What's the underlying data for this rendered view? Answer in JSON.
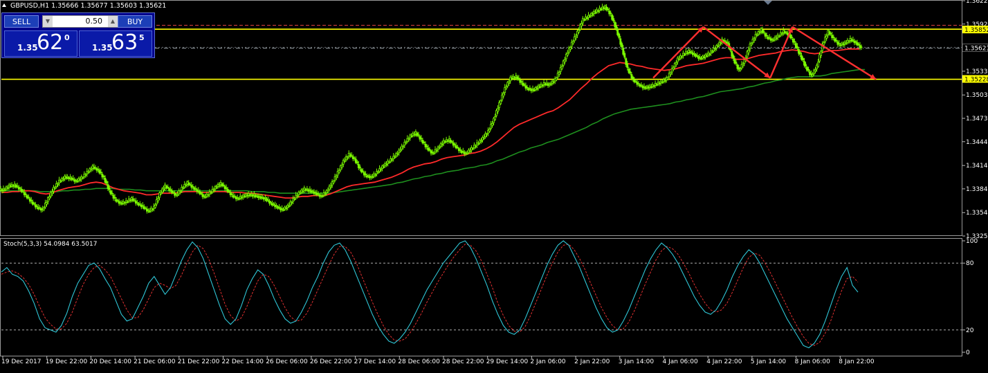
{
  "header": {
    "title": "GBPUSD,H1  1.35666 1.35677 1.35603 1.35621"
  },
  "one_click": {
    "sell_label": "SELL",
    "buy_label": "BUY",
    "lot": "0.50",
    "bid_prefix": "1.35",
    "bid_big": "62",
    "bid_sup": "0",
    "ask_prefix": "1.35",
    "ask_big": "63",
    "ask_sup": "5"
  },
  "colors": {
    "background": "#000000",
    "candle": "#7cfc00",
    "ma_fast": "#ff2a2a",
    "ma_slow": "#1e8f1e",
    "level": "#ffff00",
    "arrows": "#ff3030",
    "stoch_main": "#2fc6d6",
    "stoch_signal": "#e03030",
    "axis_text": "#ffffff"
  },
  "chart_data": [
    {
      "type": "candlestick",
      "symbol": "GBPUSD",
      "timeframe": "H1",
      "ohlc_current": {
        "open": 1.35666,
        "high": 1.35677,
        "low": 1.35603,
        "close": 1.35621
      },
      "price_ticks": [
        "1.36220",
        "1.35925",
        "1.35621",
        "1.35330",
        "1.35030",
        "1.34735",
        "1.34440",
        "1.34140",
        "1.33845",
        "1.33545",
        "1.33250"
      ],
      "ylim": [
        1.3325,
        1.3622
      ],
      "tick_values": [
        1.3622,
        1.35925,
        1.35625,
        1.3533,
        1.3503,
        1.34735,
        1.3444,
        1.3414,
        1.33845,
        1.33545,
        1.3325
      ],
      "time_labels": [
        "19 Dec 2017",
        "19 Dec 22:00",
        "20 Dec 14:00",
        "21 Dec 06:00",
        "21 Dec 22:00",
        "22 Dec 14:00",
        "26 Dec 06:00",
        "26 Dec 22:00",
        "27 Dec 14:00",
        "28 Dec 06:00",
        "28 Dec 22:00",
        "29 Dec 14:00",
        "2 Jan 06:00",
        "2 Jan 22:00",
        "3 Jan 14:00",
        "4 Jan 06:00",
        "4 Jan 22:00",
        "5 Jan 14:00",
        "8 Jan 06:00",
        "8 Jan 22:00"
      ],
      "price_labels": [
        {
          "text": "1.35852",
          "value": 1.35852,
          "highlight": true
        },
        {
          "text": "1.35621",
          "value": 1.35621,
          "highlight": false
        },
        {
          "text": "1.35228",
          "value": 1.35228,
          "highlight": true
        }
      ],
      "horizontal_levels": [
        1.35228,
        1.3586
      ],
      "closes": [
        1.3383,
        1.3388,
        1.3389,
        1.3384,
        1.3376,
        1.3368,
        1.3361,
        1.3358,
        1.3372,
        1.3385,
        1.3394,
        1.3399,
        1.3398,
        1.3394,
        1.3398,
        1.3405,
        1.3412,
        1.3408,
        1.3398,
        1.3382,
        1.3371,
        1.3366,
        1.3368,
        1.3372,
        1.3366,
        1.3362,
        1.3356,
        1.3361,
        1.3378,
        1.3388,
        1.3382,
        1.3376,
        1.3385,
        1.3392,
        1.3386,
        1.3381,
        1.3374,
        1.3379,
        1.3386,
        1.3391,
        1.3384,
        1.3376,
        1.3372,
        1.3375,
        1.3377,
        1.3376,
        1.3374,
        1.3372,
        1.3366,
        1.3362,
        1.3358,
        1.3362,
        1.3371,
        1.3379,
        1.3384,
        1.3382,
        1.3379,
        1.3375,
        1.3381,
        1.3392,
        1.3405,
        1.3419,
        1.3428,
        1.3422,
        1.3409,
        1.3401,
        1.3399,
        1.3405,
        1.3412,
        1.3418,
        1.3424,
        1.3432,
        1.3442,
        1.3451,
        1.3455,
        1.3446,
        1.3436,
        1.3429,
        1.3436,
        1.3444,
        1.3446,
        1.3439,
        1.3432,
        1.3429,
        1.3435,
        1.3441,
        1.3448,
        1.3457,
        1.3472,
        1.3492,
        1.3511,
        1.3524,
        1.3526,
        1.3518,
        1.3511,
        1.3509,
        1.3513,
        1.3517,
        1.3516,
        1.3522,
        1.3536,
        1.3553,
        1.3568,
        1.3582,
        1.3598,
        1.3602,
        1.3607,
        1.3611,
        1.3614,
        1.3604,
        1.3586,
        1.3562,
        1.3536,
        1.3522,
        1.3516,
        1.3512,
        1.3513,
        1.3516,
        1.3519,
        1.3523,
        1.3535,
        1.3548,
        1.3554,
        1.3558,
        1.3554,
        1.3549,
        1.3552,
        1.3557,
        1.3564,
        1.3572,
        1.3568,
        1.3548,
        1.3534,
        1.3546,
        1.3566,
        1.3578,
        1.3585,
        1.3576,
        1.3572,
        1.3577,
        1.3583,
        1.3579,
        1.3568,
        1.3553,
        1.3538,
        1.3527,
        1.3539,
        1.3566,
        1.3583,
        1.3574,
        1.3566,
        1.3568,
        1.3573,
        1.3569,
        1.3562
      ],
      "ma_fast": [
        1.338,
        1.338,
        1.3381,
        1.3381,
        1.3382,
        1.3382,
        1.3381,
        1.3379,
        1.3378,
        1.3379,
        1.3382,
        1.3384,
        1.3386,
        1.3387,
        1.3388,
        1.339,
        1.3392,
        1.3393,
        1.3392,
        1.3389,
        1.3386,
        1.3384,
        1.3382,
        1.3381,
        1.338,
        1.3379,
        1.3377,
        1.3377,
        1.3378,
        1.3379,
        1.3379,
        1.3379,
        1.338,
        1.3381,
        1.3381,
        1.3381,
        1.338,
        1.338,
        1.3381,
        1.3381,
        1.3381,
        1.338,
        1.338,
        1.338,
        1.3379,
        1.3379,
        1.3378,
        1.3377,
        1.3376,
        1.3375,
        1.3374,
        1.3373,
        1.3373,
        1.3374,
        1.3375,
        1.3375,
        1.3376,
        1.3376,
        1.3376,
        1.3378,
        1.3381,
        1.3384,
        1.3387,
        1.3389,
        1.339,
        1.3391,
        1.3392,
        1.3393,
        1.3395,
        1.3397,
        1.3399,
        1.3402,
        1.3405,
        1.3409,
        1.3412,
        1.3414,
        1.3416,
        1.3417,
        1.3419,
        1.3422,
        1.3424,
        1.3425,
        1.3426,
        1.3427,
        1.3429,
        1.343,
        1.3432,
        1.3435,
        1.3439,
        1.3444,
        1.345,
        1.3456,
        1.3462,
        1.3466,
        1.3469,
        1.3472,
        1.3475,
        1.3478,
        1.3481,
        1.3483,
        1.3487,
        1.3492,
        1.3497,
        1.3504,
        1.3511,
        1.3517,
        1.3524,
        1.353,
        1.3535,
        1.354,
        1.3542,
        1.3544,
        1.3543,
        1.3542,
        1.354,
        1.3539,
        1.3537,
        1.3536,
        1.3535,
        1.3534,
        1.3535,
        1.3536,
        1.3538,
        1.354,
        1.3541,
        1.3542,
        1.3543,
        1.3545,
        1.3547,
        1.3549,
        1.355,
        1.355,
        1.3548,
        1.3548,
        1.3549,
        1.3551,
        1.3553,
        1.3554,
        1.3555,
        1.3556,
        1.3558,
        1.3559,
        1.356,
        1.3559,
        1.3558,
        1.3556,
        1.3555,
        1.3556,
        1.3558,
        1.3559,
        1.3559,
        1.356,
        1.3561,
        1.3561,
        1.3561
      ],
      "ma_slow": [
        1.3382,
        1.3382,
        1.3382,
        1.3382,
        1.3382,
        1.3382,
        1.3382,
        1.3381,
        1.3381,
        1.3381,
        1.3381,
        1.3382,
        1.3382,
        1.3383,
        1.3383,
        1.3384,
        1.3384,
        1.3385,
        1.3385,
        1.3385,
        1.3385,
        1.3384,
        1.3384,
        1.3384,
        1.3383,
        1.3383,
        1.3382,
        1.3382,
        1.3382,
        1.3382,
        1.3382,
        1.3382,
        1.3382,
        1.3382,
        1.3382,
        1.3382,
        1.3382,
        1.3382,
        1.3382,
        1.3382,
        1.3382,
        1.3382,
        1.3382,
        1.3382,
        1.3382,
        1.3381,
        1.3381,
        1.3381,
        1.338,
        1.338,
        1.3379,
        1.3379,
        1.3379,
        1.3379,
        1.3379,
        1.3379,
        1.3379,
        1.3379,
        1.3379,
        1.3379,
        1.338,
        1.3381,
        1.3382,
        1.3383,
        1.3384,
        1.3385,
        1.3386,
        1.3387,
        1.3388,
        1.3389,
        1.339,
        1.3392,
        1.3393,
        1.3395,
        1.3397,
        1.3398,
        1.34,
        1.3401,
        1.3403,
        1.3404,
        1.3406,
        1.3407,
        1.3408,
        1.341,
        1.3411,
        1.3412,
        1.3414,
        1.3415,
        1.3417,
        1.342,
        1.3422,
        1.3425,
        1.3428,
        1.3431,
        1.3433,
        1.3436,
        1.3438,
        1.344,
        1.3443,
        1.3445,
        1.3447,
        1.345,
        1.3453,
        1.3456,
        1.3459,
        1.3462,
        1.3466,
        1.3469,
        1.3473,
        1.3476,
        1.3479,
        1.3481,
        1.3483,
        1.3485,
        1.3486,
        1.3487,
        1.3488,
        1.3489,
        1.349,
        1.3491,
        1.3492,
        1.3494,
        1.3495,
        1.3497,
        1.3498,
        1.35,
        1.3501,
        1.3503,
        1.3505,
        1.3507,
        1.3508,
        1.3509,
        1.351,
        1.3511,
        1.3513,
        1.3514,
        1.3516,
        1.3518,
        1.3519,
        1.3521,
        1.3522,
        1.3524,
        1.3525,
        1.3526,
        1.3526,
        1.3526,
        1.3527,
        1.3527,
        1.3528,
        1.353,
        1.3531,
        1.3532,
        1.3533,
        1.3534,
        1.3535,
        1.3535
      ],
      "arrows": [
        {
          "from": [
            117,
            1.35245
          ],
          "to": [
            126,
            1.3589
          ]
        },
        {
          "from": [
            126,
            1.3589
          ],
          "to": [
            138,
            1.35245
          ]
        },
        {
          "from": [
            138,
            1.35245
          ],
          "to": [
            142,
            1.3589
          ]
        },
        {
          "from": [
            142,
            1.3589
          ],
          "to": [
            157,
            1.35228
          ]
        }
      ]
    },
    {
      "type": "line",
      "title": "Stoch(5,3,3) 54.0984 63.5017",
      "main_value": 54.0984,
      "signal_value": 63.5017,
      "ylim": [
        0,
        100
      ],
      "levels": [
        20,
        80
      ],
      "ticks": [
        "100",
        "80",
        "20",
        "0"
      ],
      "main": [
        72,
        76,
        70,
        68,
        64,
        55,
        44,
        30,
        22,
        20,
        18,
        24,
        35,
        50,
        62,
        70,
        78,
        80,
        75,
        66,
        58,
        46,
        34,
        28,
        30,
        40,
        50,
        62,
        68,
        60,
        52,
        58,
        70,
        82,
        92,
        99,
        94,
        84,
        70,
        56,
        42,
        30,
        25,
        30,
        42,
        56,
        66,
        74,
        70,
        60,
        48,
        38,
        30,
        26,
        28,
        36,
        46,
        58,
        68,
        80,
        90,
        96,
        98,
        92,
        82,
        70,
        58,
        46,
        34,
        24,
        16,
        10,
        8,
        12,
        18,
        26,
        36,
        46,
        56,
        64,
        72,
        80,
        86,
        92,
        98,
        100,
        94,
        84,
        72,
        60,
        46,
        34,
        24,
        18,
        16,
        20,
        30,
        42,
        54,
        66,
        78,
        88,
        96,
        100,
        96,
        86,
        76,
        64,
        52,
        40,
        30,
        22,
        18,
        20,
        28,
        38,
        50,
        62,
        74,
        84,
        92,
        98,
        94,
        88,
        80,
        70,
        60,
        50,
        42,
        36,
        34,
        38,
        46,
        56,
        68,
        78,
        86,
        92,
        88,
        80,
        70,
        60,
        50,
        40,
        30,
        22,
        14,
        6,
        4,
        8,
        16,
        28,
        42,
        56,
        68,
        76,
        60,
        54
      ],
      "signal": [
        70,
        72,
        73,
        71,
        67,
        61,
        52,
        41,
        31,
        25,
        21,
        21,
        26,
        36,
        49,
        61,
        70,
        76,
        78,
        74,
        68,
        58,
        48,
        38,
        31,
        31,
        38,
        48,
        58,
        62,
        60,
        57,
        60,
        69,
        80,
        90,
        96,
        93,
        84,
        71,
        57,
        43,
        33,
        28,
        31,
        41,
        53,
        64,
        70,
        68,
        60,
        50,
        40,
        32,
        28,
        29,
        35,
        45,
        56,
        67,
        78,
        88,
        95,
        95,
        90,
        81,
        69,
        57,
        45,
        34,
        24,
        16,
        11,
        10,
        12,
        18,
        26,
        35,
        45,
        54,
        63,
        71,
        79,
        86,
        92,
        97,
        96,
        91,
        82,
        70,
        58,
        44,
        33,
        24,
        19,
        18,
        23,
        33,
        45,
        57,
        69,
        80,
        90,
        96,
        97,
        92,
        84,
        74,
        62,
        51,
        40,
        31,
        24,
        20,
        21,
        27,
        37,
        49,
        61,
        72,
        83,
        91,
        95,
        93,
        88,
        80,
        71,
        61,
        52,
        44,
        38,
        36,
        38,
        44,
        54,
        65,
        76,
        85,
        89,
        87,
        80,
        71,
        61,
        51,
        41,
        31,
        22,
        14,
        8,
        6,
        9,
        17,
        28,
        42,
        55,
        66,
        68,
        63
      ]
    }
  ]
}
